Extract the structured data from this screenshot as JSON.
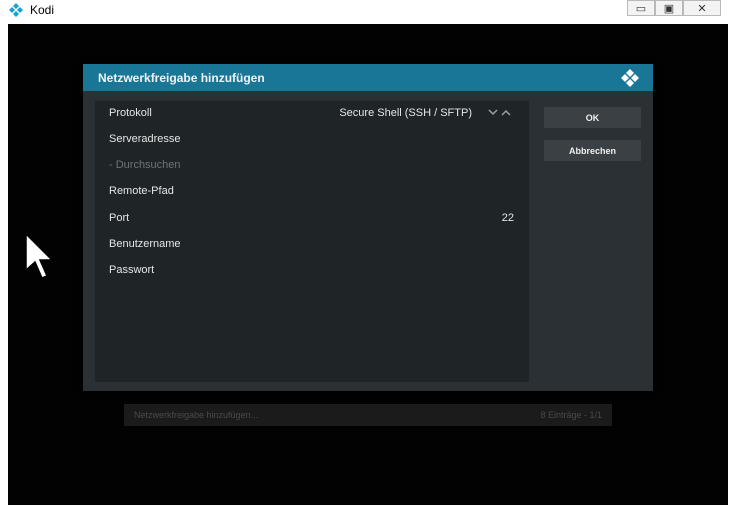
{
  "window": {
    "title": "Kodi",
    "minimize_glyph": "▭",
    "maximize_glyph": "▣",
    "close_glyph": "✕"
  },
  "background": {
    "footer_left": "Netzwerkfreigabe hinzufügen...",
    "footer_right": "8 Einträge - 1/1"
  },
  "dialog": {
    "title": "Netzwerkfreigabe hinzufügen",
    "header_color": "#1a7696",
    "rows": [
      {
        "label": "Protokoll",
        "value": "Secure Shell (SSH / SFTP)"
      },
      {
        "label": "Serveradresse",
        "value": ""
      },
      {
        "label": "- Durchsuchen",
        "value": "",
        "disabled": true
      },
      {
        "label": "Remote-Pfad",
        "value": ""
      },
      {
        "label": "Port",
        "value": "22"
      },
      {
        "label": "Benutzername",
        "value": ""
      },
      {
        "label": "Passwort",
        "value": ""
      }
    ],
    "ok_label": "OK",
    "cancel_label": "Abbrechen"
  },
  "icons": [
    "kodi-logo-icon",
    "spin-down-icon",
    "spin-up-icon",
    "mouse-cursor-icon"
  ]
}
